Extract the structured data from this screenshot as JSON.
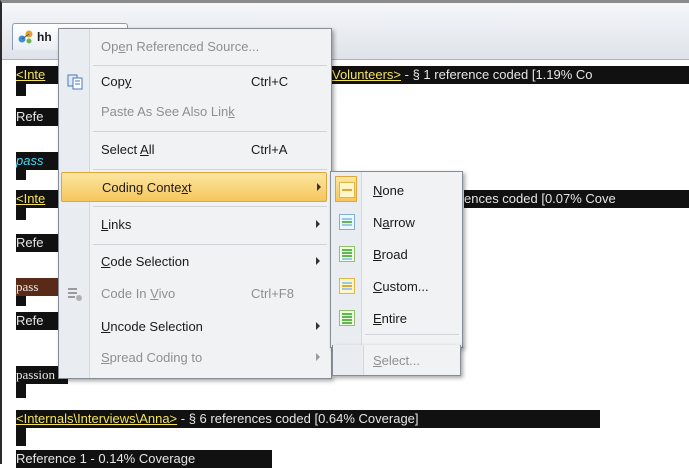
{
  "tab": {
    "label": "hh"
  },
  "document": {
    "lines": [
      {
        "link": "<Inte",
        "meta": ""
      },
      {
        "link": "Volunteers>",
        "meta": " - § 1 reference coded  [1.19% Co"
      },
      {
        "text": "Refe"
      },
      {
        "text": "pass"
      },
      {
        "link": "<Inte",
        "meta": ""
      },
      {
        "meta": "ences coded  [0.07% Cove"
      },
      {
        "text": "Refe"
      },
      {
        "text": "pass"
      },
      {
        "text": "Refe"
      },
      {
        "text": "passion"
      },
      {
        "link": "<Internals\\Interviews\\Anna>",
        "meta": " - § 6 references coded  [0.64% Coverage]"
      },
      {
        "text": "Reference 1 - 0.14% Coverage"
      }
    ]
  },
  "context_menu": {
    "items": [
      {
        "label_pre": "Op",
        "label_u": "e",
        "label_post": "n Referenced Source...",
        "shortcut": ""
      },
      {
        "label_pre": "Cop",
        "label_u": "y",
        "label_post": "",
        "shortcut": "Ctrl+C"
      },
      {
        "label_pre": "Paste As See Also Lin",
        "label_u": "k",
        "label_post": "",
        "shortcut": ""
      },
      {
        "label_pre": "Select ",
        "label_u": "A",
        "label_post": "ll",
        "shortcut": "Ctrl+A"
      },
      {
        "label_pre": "Coding Conte",
        "label_u": "x",
        "label_post": "t",
        "shortcut": ""
      },
      {
        "label_pre": "",
        "label_u": "L",
        "label_post": "inks",
        "shortcut": ""
      },
      {
        "label_pre": "",
        "label_u": "C",
        "label_post": "ode Selection",
        "shortcut": ""
      },
      {
        "label_pre": "Code In ",
        "label_u": "V",
        "label_post": "ivo",
        "shortcut": "Ctrl+F8"
      },
      {
        "label_pre": "",
        "label_u": "U",
        "label_post": "ncode Selection",
        "shortcut": ""
      },
      {
        "label_pre": "",
        "label_u": "S",
        "label_post": "pread Coding to",
        "shortcut": ""
      }
    ]
  },
  "coding_context_submenu": {
    "items": [
      {
        "label_pre": "",
        "label_u": "N",
        "label_post": "one"
      },
      {
        "label_pre": "N",
        "label_u": "a",
        "label_post": "rrow"
      },
      {
        "label_pre": "",
        "label_u": "B",
        "label_post": "road"
      },
      {
        "label_pre": "",
        "label_u": "C",
        "label_post": "ustom..."
      },
      {
        "label_pre": "",
        "label_u": "E",
        "label_post": "ntire"
      },
      {
        "label_pre": "",
        "label_u": "S",
        "label_post": "elect..."
      }
    ]
  },
  "colors": {
    "highlight": "#f6c65d",
    "link": "#f4e35a",
    "dark_bg": "#111111"
  }
}
